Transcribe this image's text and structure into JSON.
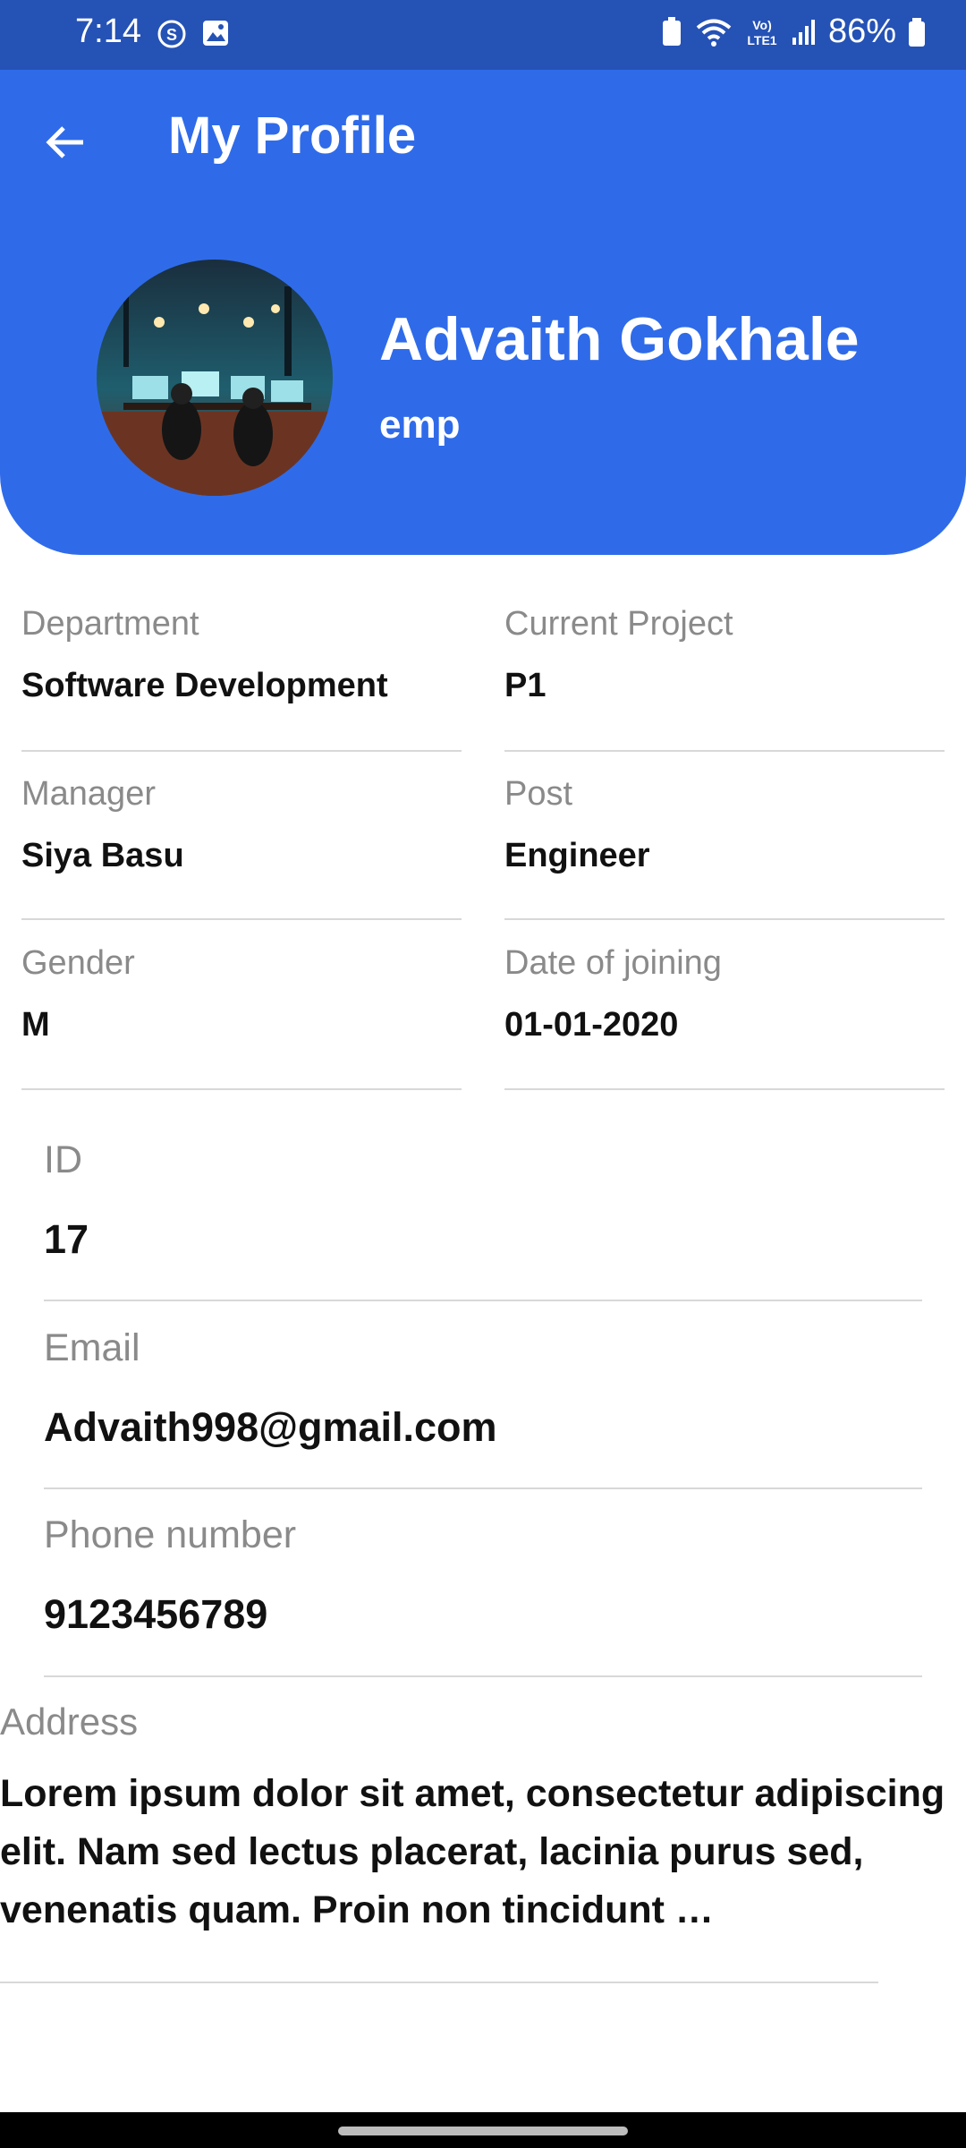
{
  "status_bar": {
    "time": "7:14",
    "battery": "86%",
    "network_label": "Vo) LTE1"
  },
  "header": {
    "title": "My Profile",
    "name": "Advaith Gokhale",
    "role": "emp"
  },
  "fields": {
    "department": {
      "label": "Department",
      "value": "Software Development"
    },
    "current_project": {
      "label": "Current Project",
      "value": "P1"
    },
    "manager": {
      "label": "Manager",
      "value": "Siya Basu"
    },
    "post": {
      "label": "Post",
      "value": "Engineer"
    },
    "gender": {
      "label": "Gender",
      "value": "M"
    },
    "date_of_joining": {
      "label": "Date of joining",
      "value": "01-01-2020"
    },
    "id": {
      "label": "ID",
      "value": "17"
    },
    "email": {
      "label": "Email",
      "value": "Advaith998@gmail.com"
    },
    "phone": {
      "label": "Phone number",
      "value": "9123456789"
    },
    "address": {
      "label": "Address",
      "value": "Lorem ipsum dolor sit amet, consectetur adipiscing elit. Nam sed lectus placerat, lacinia purus sed, venenatis quam. Proin non tincidunt …"
    }
  },
  "colors": {
    "header_blue": "#2f6be9",
    "status_blue": "#2552b5"
  }
}
